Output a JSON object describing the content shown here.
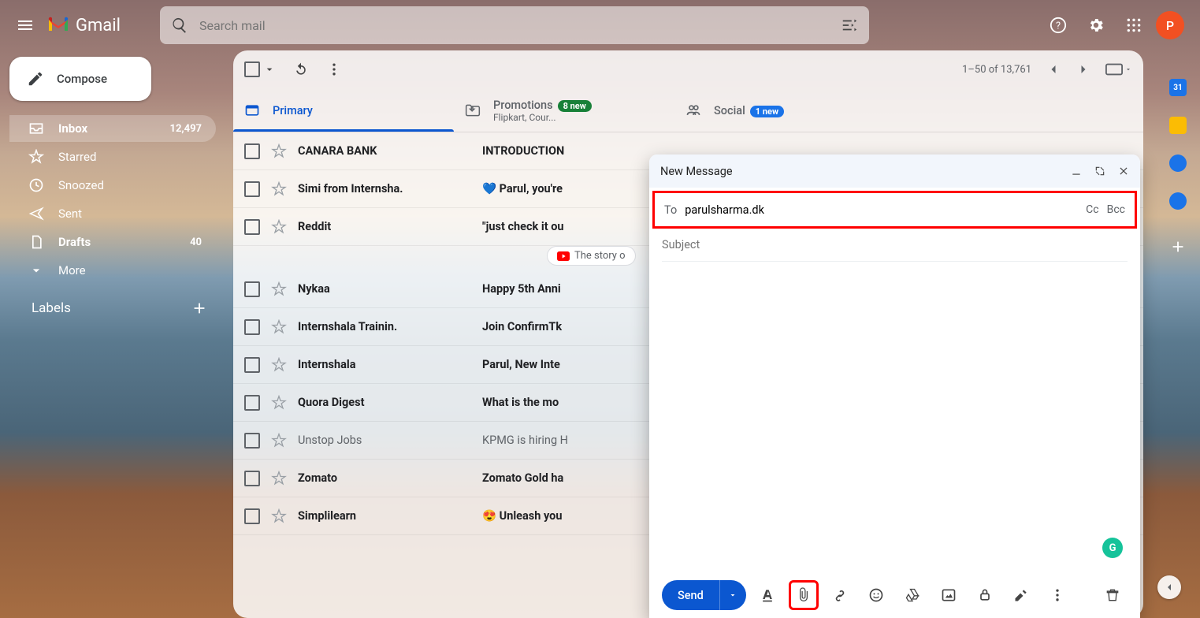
{
  "header": {
    "app_name": "Gmail",
    "search_placeholder": "Search mail",
    "avatar_initial": "P"
  },
  "sidebar": {
    "compose_label": "Compose",
    "items": [
      {
        "icon": "inbox",
        "label": "Inbox",
        "count": "12,497",
        "active": true,
        "bold": true
      },
      {
        "icon": "star",
        "label": "Starred"
      },
      {
        "icon": "clock",
        "label": "Snoozed"
      },
      {
        "icon": "send",
        "label": "Sent"
      },
      {
        "icon": "file",
        "label": "Drafts",
        "count": "40",
        "bold": true
      },
      {
        "icon": "down",
        "label": "More"
      }
    ],
    "labels_title": "Labels"
  },
  "toolbar": {
    "page_info": "1–50 of 13,761"
  },
  "tabs": [
    {
      "label": "Primary",
      "active": true
    },
    {
      "label": "Promotions",
      "badge": "8 new",
      "badge_color": "green",
      "sub": "Flipkart, Cour..."
    },
    {
      "label": "Social",
      "badge": "1 new",
      "badge_color": "blue"
    }
  ],
  "emails": [
    {
      "sender": "CANARA BANK",
      "subject": "INTRODUCTION",
      "unread": true
    },
    {
      "sender": "Simi from Internsha.",
      "subject": "💙 Parul, you're",
      "unread": true
    },
    {
      "sender": "Reddit",
      "subject": "\"just check it ou",
      "unread": true,
      "chip": "The story o"
    },
    {
      "sender": "Nykaa",
      "subject": "Happy 5th Anni",
      "unread": true
    },
    {
      "sender": "Internshala Trainin.",
      "subject": "Join ConfirmTk",
      "unread": true
    },
    {
      "sender": "Internshala",
      "subject": "Parul, New Inte",
      "unread": true
    },
    {
      "sender": "Quora Digest",
      "subject": "What is the mo",
      "unread": true
    },
    {
      "sender": "Unstop Jobs",
      "subject": "KPMG is hiring H",
      "unread": false
    },
    {
      "sender": "Zomato",
      "subject": "Zomato Gold ha",
      "unread": true
    },
    {
      "sender": "Simplilearn",
      "subject": "😍 Unleash you",
      "unread": true
    }
  ],
  "compose_dialog": {
    "title": "New Message",
    "to_label": "To",
    "to_value": "parulsharma.dk",
    "cc_label": "Cc",
    "bcc_label": "Bcc",
    "subject_placeholder": "Subject",
    "send_label": "Send",
    "grammarly": "G"
  },
  "rightbar": {
    "calendar_day": "31"
  }
}
